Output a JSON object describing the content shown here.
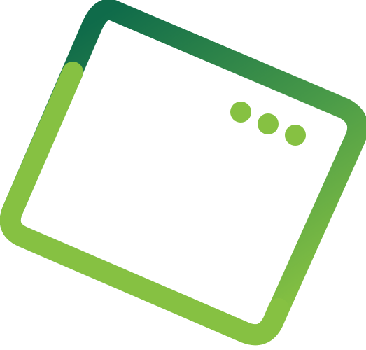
{
  "logo": {
    "icon": "tilted-browser-window-icon",
    "colors": {
      "dark_green": "#0f6b4a",
      "mid_green": "#4a9b48",
      "light_green": "#86c142",
      "dot_green": "#86c142",
      "inner_fill": "#ffffff"
    }
  }
}
